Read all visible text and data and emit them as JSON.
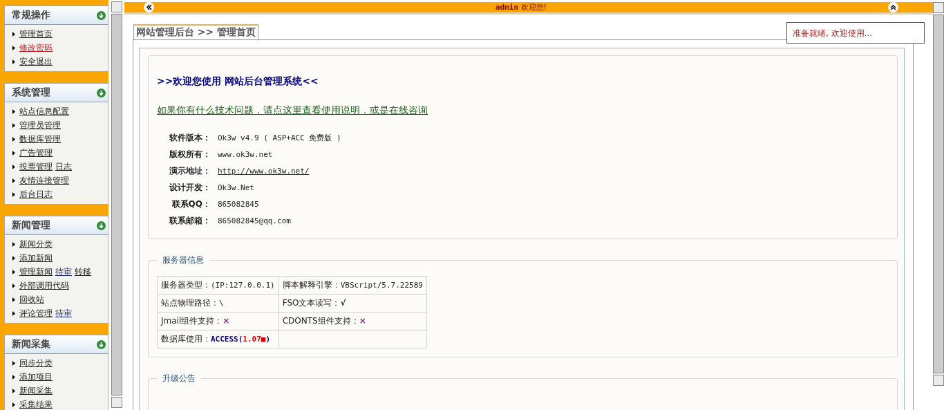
{
  "sidebar": {
    "groups": [
      {
        "title": "常规操作",
        "items": [
          {
            "label": "管理首页",
            "selected": false
          },
          {
            "label": "修改密码",
            "selected": true
          },
          {
            "label": "安全退出",
            "selected": false
          }
        ]
      },
      {
        "title": "系统管理",
        "items": [
          {
            "label": "站点信息配置",
            "selected": false
          },
          {
            "label": "管理员管理",
            "selected": false
          },
          {
            "label": "数据库管理",
            "selected": false
          },
          {
            "label": "广告管理",
            "selected": false
          },
          {
            "label": "投票管理",
            "selected": false,
            "extras": [
              {
                "label": "日志",
                "kind": "normal"
              }
            ]
          },
          {
            "label": "友情连接管理",
            "selected": false
          },
          {
            "label": "后台日志",
            "selected": false
          }
        ]
      },
      {
        "title": "新闻管理",
        "items": [
          {
            "label": "新闻分类",
            "selected": false
          },
          {
            "label": "添加新闻",
            "selected": false
          },
          {
            "label": "管理新闻",
            "selected": false,
            "extras": [
              {
                "label": "待审",
                "kind": "accent"
              },
              {
                "label": "转移",
                "kind": "normal"
              }
            ]
          },
          {
            "label": "外部调用代码",
            "selected": false
          },
          {
            "label": "回收站",
            "selected": false
          },
          {
            "label": "评论管理",
            "selected": false,
            "extras": [
              {
                "label": "待审",
                "kind": "accent"
              }
            ]
          }
        ]
      },
      {
        "title": "新闻采集",
        "items": [
          {
            "label": "同步分类",
            "selected": false
          },
          {
            "label": "添加项目",
            "selected": false
          },
          {
            "label": "新闻采集",
            "selected": false
          },
          {
            "label": "采集结果",
            "selected": false
          }
        ]
      }
    ]
  },
  "topbar": {
    "user": "admin",
    "greeting": "欢迎您!"
  },
  "status": "准备就绪, 欢迎使用...",
  "tab": {
    "label": "网站管理后台 >> 管理首页"
  },
  "welcome": {
    "title": ">>欢迎您使用 网站后台管理系统<<",
    "help_link": "如果你有什么技术问题，请点这里查看使用说明，或是在线咨询",
    "info": [
      {
        "label": "软件版本：",
        "value": "Ok3w v4.9 ( ASP+ACC 免费版 )",
        "kind": "text"
      },
      {
        "label": "版权所有：",
        "value": "www.ok3w.net",
        "kind": "text"
      },
      {
        "label": "演示地址：",
        "value": "http://www.ok3w.net/",
        "kind": "link"
      },
      {
        "label": "设计开发：",
        "value": "Ok3w.Net",
        "kind": "text"
      },
      {
        "label": "联系QQ：",
        "value": "865082845",
        "kind": "text"
      },
      {
        "label": "联系邮箱：",
        "value": "865082845@qq.com",
        "kind": "text"
      }
    ]
  },
  "server": {
    "legend": "服务器信息",
    "rows": [
      [
        {
          "label": "服务器类型：",
          "kind": "text",
          "value": "(IP:127.0.0.1)"
        },
        {
          "label": "脚本解释引擎：",
          "kind": "text",
          "value": "VBScript/5.7.22589"
        }
      ],
      [
        {
          "label": "站点物理路径：",
          "kind": "text",
          "value": "\\"
        },
        {
          "label": "FSO文本读写：",
          "kind": "ok",
          "value": "√"
        }
      ],
      [
        {
          "label": "Jmail组件支持：",
          "kind": "no",
          "value": "×"
        },
        {
          "label": "CDONTS组件支持：",
          "kind": "no",
          "value": "×"
        }
      ],
      [
        {
          "label": "数据库使用：",
          "kind": "db",
          "value": "ACCESS(",
          "size": "1.07■",
          "tail": ")"
        },
        {
          "kind": "empty"
        }
      ]
    ]
  },
  "upgrade": {
    "legend": "升级公告"
  }
}
